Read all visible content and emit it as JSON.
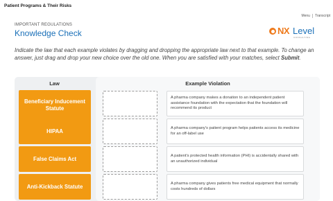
{
  "header": {
    "course_title": "Patient Programs & Their Risks",
    "links": [
      "Menu",
      "Transcript"
    ]
  },
  "subheading": "IMPORTANT REGULATIONS",
  "title": "Knowledge Check",
  "logo": {
    "mark": "NX",
    "name": "Level",
    "tagline": "CONSULTING"
  },
  "instructions": {
    "part1": "Indicate the law that each example violates by dragging and dropping the appropriate law next to that example. To change an answer, just drag and drop your new choice over the old one. When you are satisfied with your matches, select ",
    "submit": "Submit",
    "part2": "."
  },
  "table": {
    "law_header": "Law",
    "example_header": "Example Violation",
    "laws": [
      "Beneficiary Inducement Statute",
      "HIPAA",
      "False Claims Act",
      "Anti-Kickback Statute"
    ],
    "examples": [
      "A pharma company makes a donation to an independent patient assistance foundation with the expectation that the foundation will recommend its product",
      "A pharma company's patient program helps patients access its medicine for an off-label use",
      "A patient's protected health information (PHI) is accidentally shared with an unauthorized individual",
      "A pharma company gives patients free medical equipment that normally costs hundreds of dollars"
    ]
  },
  "colors": {
    "accent_blue": "#1b70b8",
    "law_tile": "#f29a12",
    "logo_orange": "#ee7a1c"
  }
}
